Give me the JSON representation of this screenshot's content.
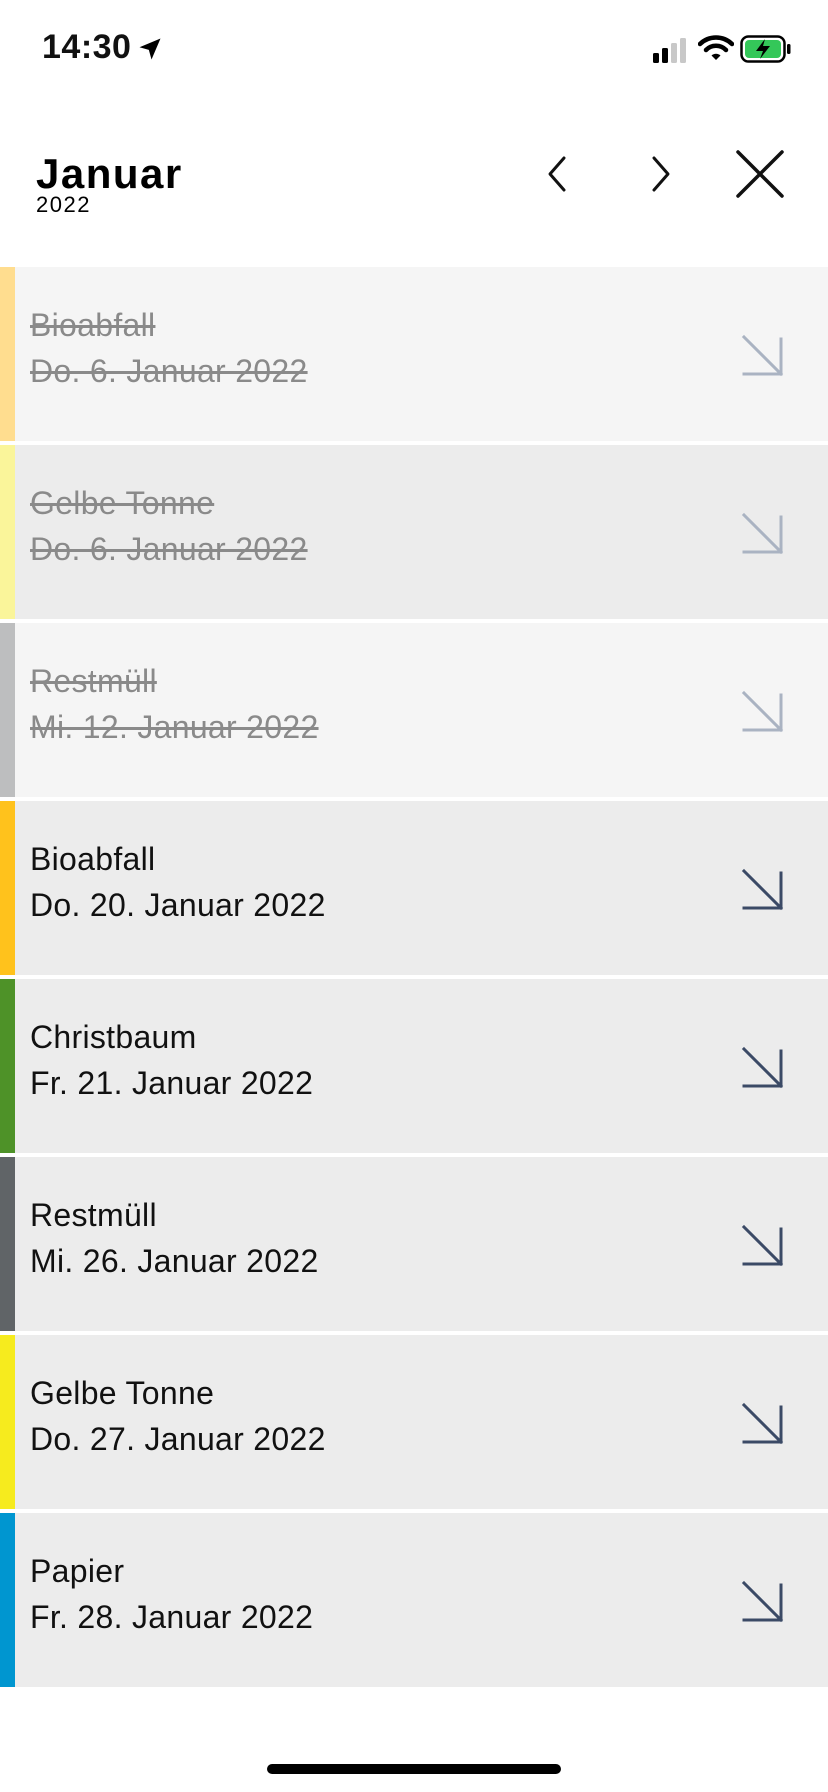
{
  "status_bar": {
    "time": "14:30",
    "icons": [
      "location-arrow-icon",
      "cellular-signal-icon",
      "wifi-icon",
      "battery-charging-icon"
    ]
  },
  "header": {
    "month": "Januar",
    "year": "2022",
    "prev_icon": "chevron-left-icon",
    "next_icon": "chevron-right-icon",
    "close_icon": "close-icon"
  },
  "colors": {
    "bioabfall": "#FFC21C",
    "gelbe_tonne": "#F6EB1E",
    "restmuell": "#606467",
    "christbaum": "#4E9228",
    "papier": "#0096D0",
    "row_bg_past": "#F5F5F5",
    "row_bg": "#ECECEC",
    "arrow": "#3B4A66"
  },
  "items": [
    {
      "name": "Bioabfall",
      "date": "Do. 6. Januar 2022",
      "color": "#FFDD8F",
      "bg": "#F5F5F5",
      "past": true
    },
    {
      "name": "Gelbe Tonne",
      "date": "Do. 6. Januar 2022",
      "color": "#FAF59A",
      "bg": "#ECECEC",
      "past": true
    },
    {
      "name": "Restmüll",
      "date": "Mi. 12. Januar 2022",
      "color": "#BDBEBF",
      "bg": "#F5F5F5",
      "past": true
    },
    {
      "name": "Bioabfall",
      "date": "Do. 20. Januar 2022",
      "color": "#FFC21C",
      "bg": "#ECECEC",
      "past": false
    },
    {
      "name": "Christbaum",
      "date": "Fr. 21. Januar 2022",
      "color": "#4E9228",
      "bg": "#ECECEC",
      "past": false
    },
    {
      "name": "Restmüll",
      "date": "Mi. 26. Januar 2022",
      "color": "#606467",
      "bg": "#ECECEC",
      "past": false
    },
    {
      "name": "Gelbe Tonne",
      "date": "Do. 27. Januar 2022",
      "color": "#F6EB1E",
      "bg": "#ECECEC",
      "past": false
    },
    {
      "name": "Papier",
      "date": "Fr. 28. Januar 2022",
      "color": "#0096D0",
      "bg": "#ECECEC",
      "past": false
    }
  ]
}
